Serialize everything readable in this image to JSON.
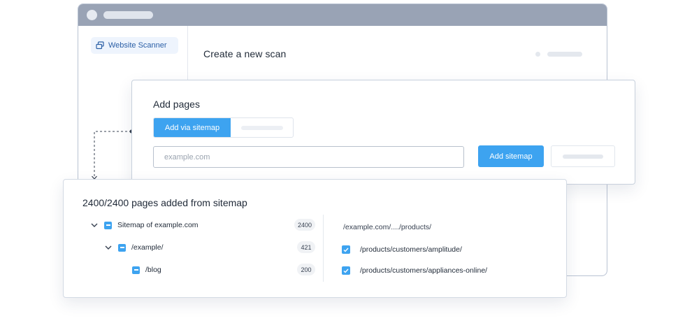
{
  "sidebar": {
    "item_label": "Website Scanner",
    "item_icon": "scanner-icon"
  },
  "main": {
    "title": "Create a new scan"
  },
  "add_pages": {
    "title": "Add pages",
    "tab_active_label": "Add via sitemap",
    "input_placeholder": "example.com",
    "input_value": "",
    "add_button_label": "Add sitemap"
  },
  "sitemap": {
    "title": "2400/2400 pages added from sitemap",
    "tree": [
      {
        "label": "Sitemap of example.com",
        "count": "2400"
      },
      {
        "label": "/example/",
        "count": "421"
      },
      {
        "label": "/blog",
        "count": "200"
      }
    ],
    "path_header": "/example.com/..../products/",
    "pages": [
      {
        "label": "/products/customers/amplitude/",
        "checked": true
      },
      {
        "label": "/products/customers/appliances-online/",
        "checked": true
      }
    ]
  },
  "colors": {
    "accent": "#3da3f0",
    "browser_bar": "#99a3b5",
    "sidebar_text": "#2b5fa6"
  }
}
